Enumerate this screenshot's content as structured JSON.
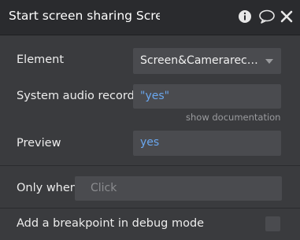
{
  "header": {
    "title": "Start screen sharing Scree",
    "icons": [
      "info-icon",
      "comment-icon",
      "close-icon"
    ]
  },
  "fields": {
    "element": {
      "label": "Element",
      "value": "Screen&Camerarecord..."
    },
    "system_audio": {
      "label": "System audio record",
      "value": "\"yes\""
    },
    "show_documentation": "show documentation",
    "preview": {
      "label": "Preview",
      "value": "yes"
    },
    "only_when": {
      "label": "Only when",
      "placeholder": "Click"
    },
    "breakpoint": {
      "label": "Add a breakpoint in debug mode",
      "checked": false
    }
  },
  "colors": {
    "header_bg": "#2a2b2e",
    "panel_bg": "#3a3b3e",
    "field_bg": "#4a4b4f",
    "value_blue": "#6aa7ef"
  }
}
